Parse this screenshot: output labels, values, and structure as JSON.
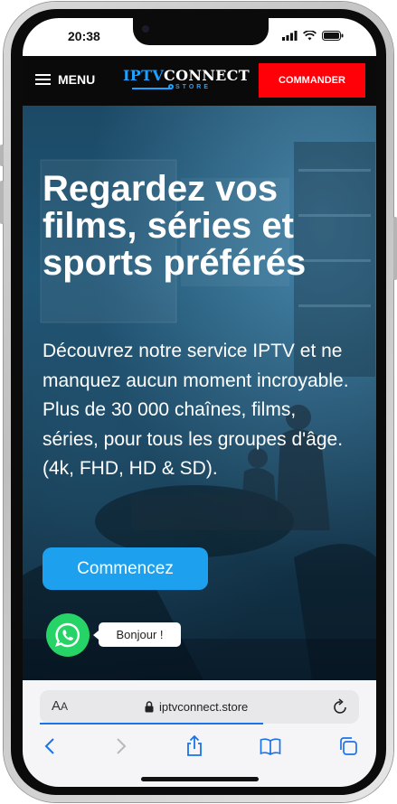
{
  "status_bar": {
    "time": "20:38"
  },
  "navbar": {
    "menu_label": "MENU",
    "logo": {
      "part1": "IPTV",
      "part2": "CONNECT",
      "sub": "STORE"
    },
    "order_button": "COMMANDER"
  },
  "hero": {
    "title": "Regardez vos films, séries et sports préférés",
    "description": "Découvrez notre service IPTV et ne manquez aucun moment incroyable. Plus de 30 000 chaînes, films, séries, pour tous les groupes d'âge. (4k, FHD, HD & SD).",
    "cta_label": "Commencez"
  },
  "whatsapp": {
    "bubble_text": "Bonjour !"
  },
  "browser": {
    "text_size_label": "AA",
    "url": "iptvconnect.store",
    "loading_progress": 0.7
  },
  "colors": {
    "accent_blue": "#1da1ee",
    "order_red": "#ff0008",
    "whatsapp_green": "#25d366",
    "navbar_bg": "#0a0a0a"
  },
  "icons": [
    "hamburger-icon",
    "signal-icon",
    "wifi-icon",
    "battery-icon",
    "whatsapp-icon",
    "lock-icon",
    "reload-icon",
    "back-icon",
    "forward-icon",
    "share-icon",
    "bookmarks-icon",
    "tabs-icon"
  ]
}
